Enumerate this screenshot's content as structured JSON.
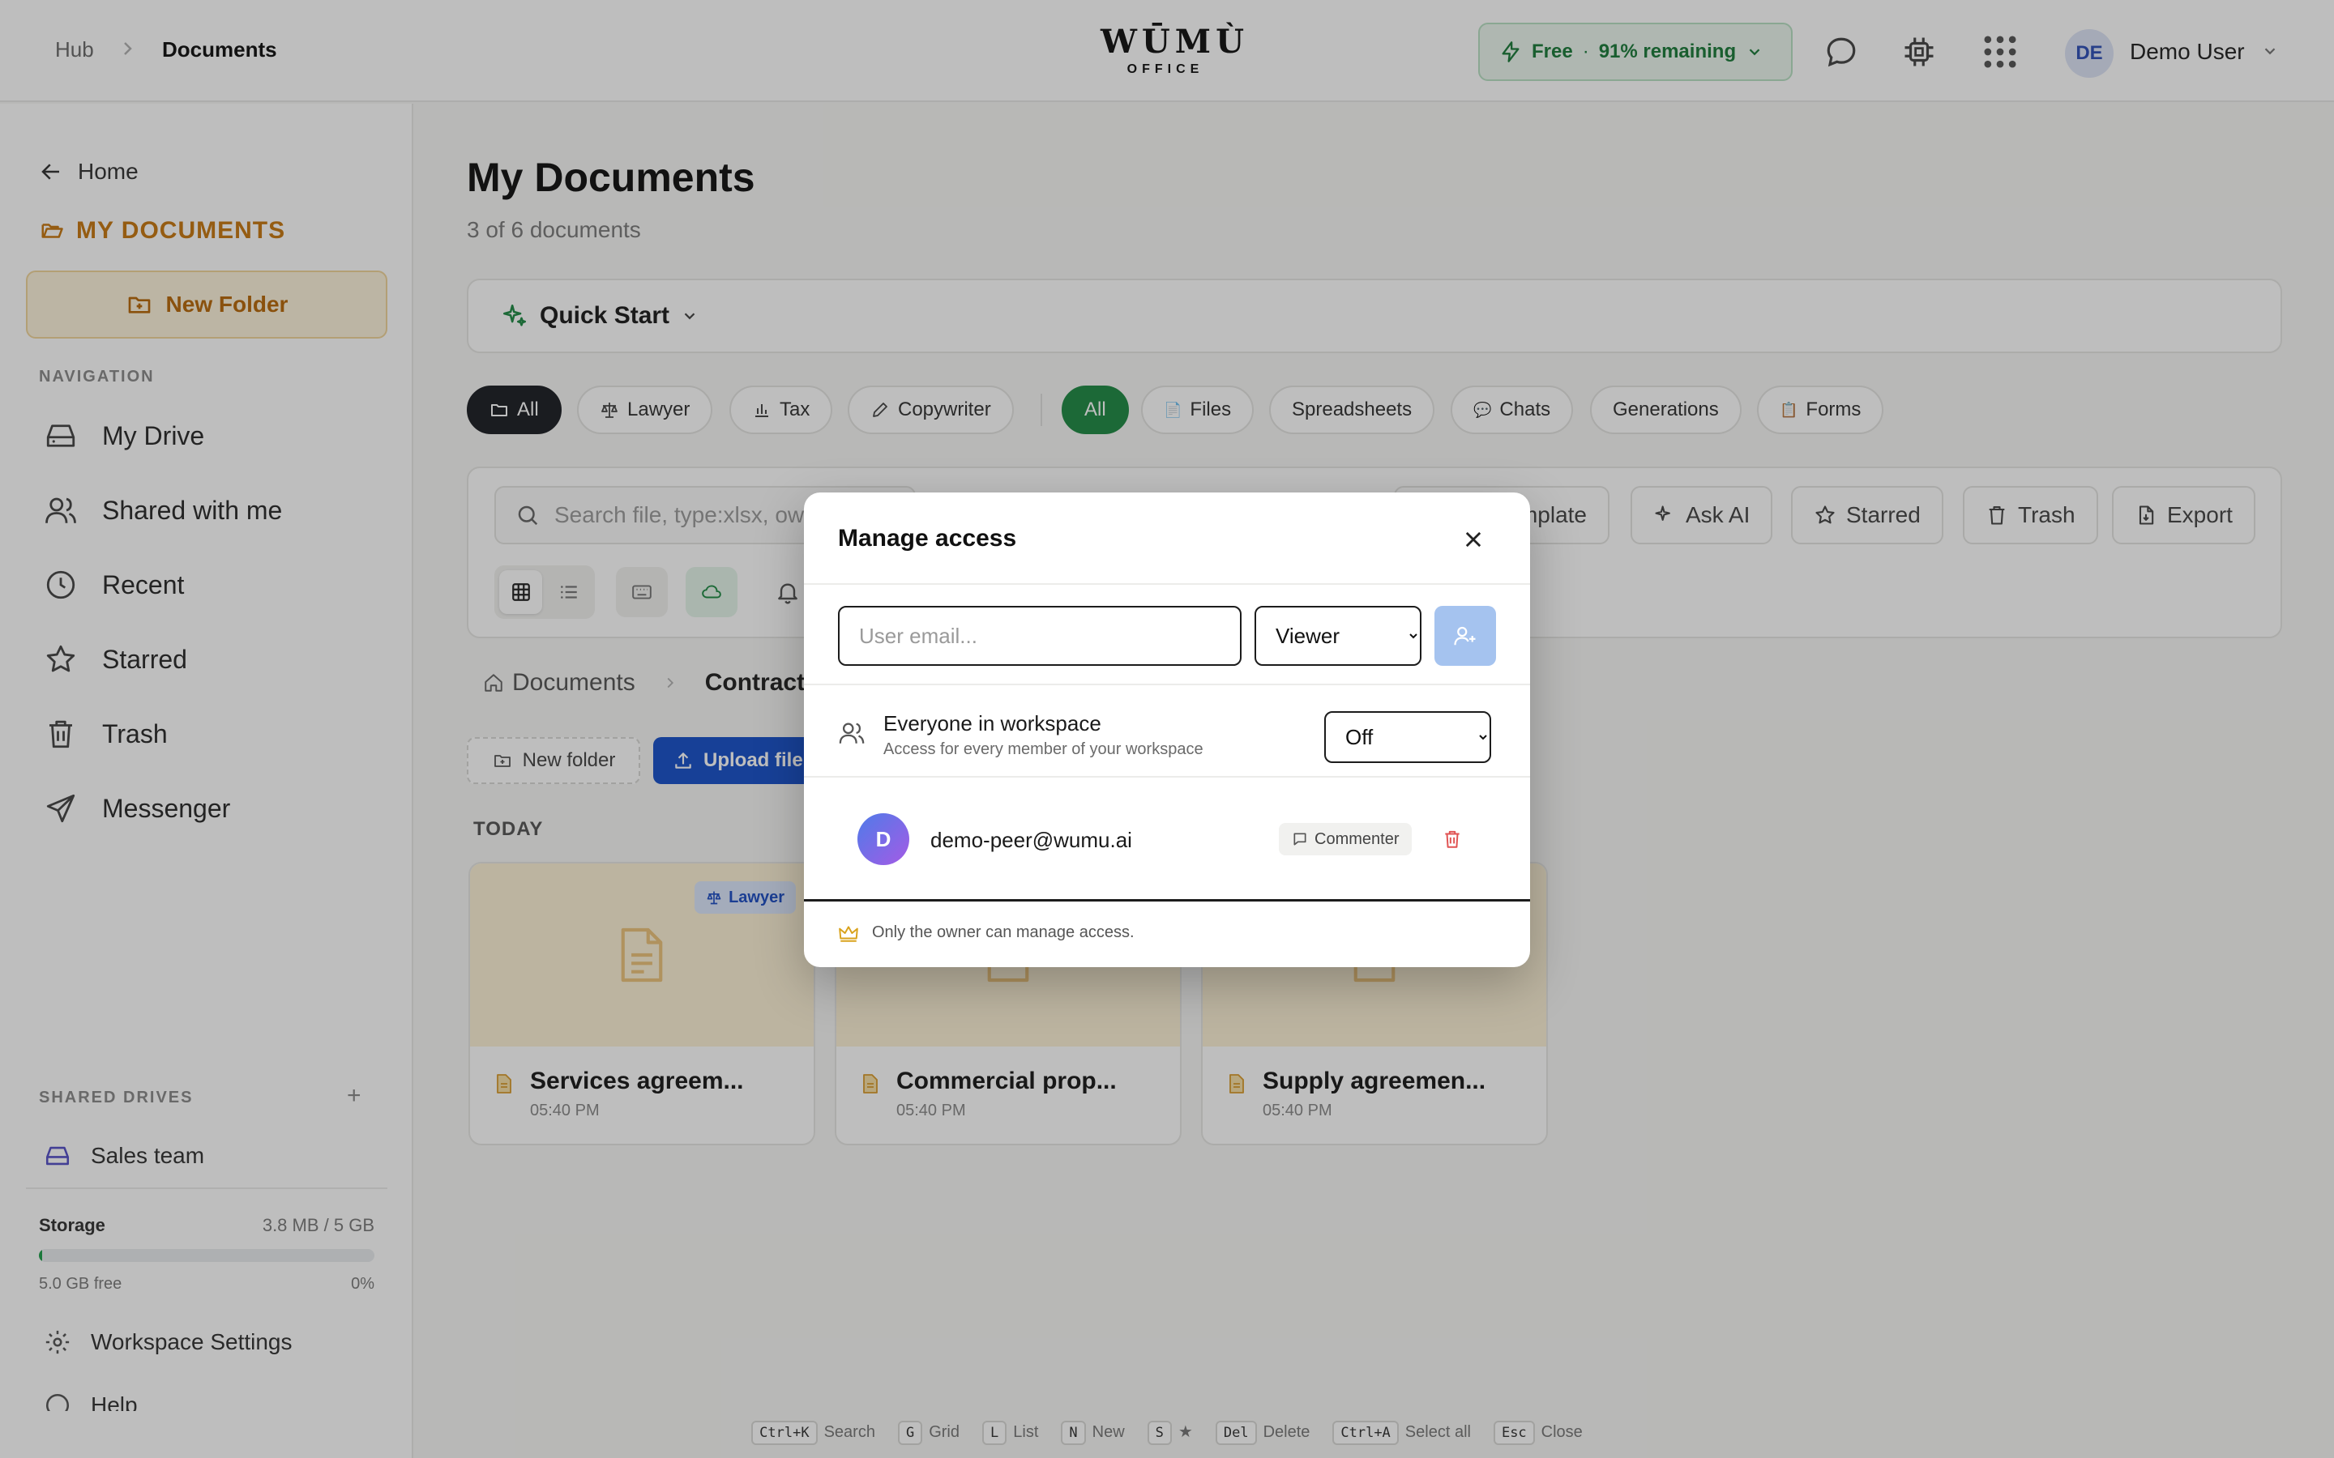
{
  "header": {
    "breadcrumb": [
      "Hub",
      "Documents"
    ],
    "logo_main": "WŪMÙ",
    "logo_sub": "OFFICE",
    "plan_label": "Free",
    "plan_sep": "·",
    "plan_remaining": "91% remaining",
    "user_initials": "DE",
    "user_name": "Demo User"
  },
  "sidebar": {
    "home": "Home",
    "my_documents": "MY DOCUMENTS",
    "new_folder": "New Folder",
    "navigation_label": "NAVIGATION",
    "nav_items": [
      {
        "label": "My Drive",
        "icon": "drive-icon"
      },
      {
        "label": "Shared with me",
        "icon": "users-icon"
      },
      {
        "label": "Recent",
        "icon": "clock-icon"
      },
      {
        "label": "Starred",
        "icon": "star-icon"
      },
      {
        "label": "Trash",
        "icon": "trash-icon"
      },
      {
        "label": "Messenger",
        "icon": "send-icon"
      }
    ],
    "shared_drives_label": "SHARED DRIVES",
    "shared_drives_add": "+",
    "shared_drives": [
      {
        "label": "Sales team"
      }
    ],
    "storage": {
      "label": "Storage",
      "used": "3.8 MB / 5 GB",
      "free": "5.0 GB free",
      "percent_label": "0%",
      "fill_fraction": 0.01
    },
    "workspace_settings": "Workspace Settings",
    "help": "Help"
  },
  "main": {
    "title": "My Documents",
    "subtitle": "3 of 6 documents",
    "quick_start": "Quick Start",
    "role_chips": [
      {
        "label": "All"
      },
      {
        "label": "Lawyer"
      },
      {
        "label": "Tax"
      },
      {
        "label": "Copywriter"
      }
    ],
    "type_chips": [
      {
        "label": "All"
      },
      {
        "label": "Files",
        "icon": "📄"
      },
      {
        "label": "Spreadsheets"
      },
      {
        "label": "Chats",
        "icon": "💬"
      },
      {
        "label": "Generations"
      },
      {
        "label": "Forms",
        "icon": "📋"
      }
    ],
    "search_placeholder": "Search file, type:xlsx, ow",
    "toolbar": {
      "template_partial": "mplate",
      "ask_ai": "Ask AI",
      "starred": "Starred",
      "trash": "Trash",
      "export": "Export"
    },
    "breadcrumb": {
      "root": "Documents",
      "current": "Contracts"
    },
    "new_folder": "New folder",
    "upload": "Upload file",
    "today": "TODAY",
    "cards": [
      {
        "title": "Services agreem...",
        "time": "05:40 PM",
        "tag": "Lawyer"
      },
      {
        "title": "Commercial prop...",
        "time": "05:40 PM"
      },
      {
        "title": "Supply agreemen...",
        "time": "05:40 PM"
      }
    ]
  },
  "shortcuts": [
    {
      "key": "Ctrl+K",
      "label": "Search"
    },
    {
      "key": "G",
      "label": "Grid"
    },
    {
      "key": "L",
      "label": "List"
    },
    {
      "key": "N",
      "label": "New"
    },
    {
      "key": "S",
      "label": "★"
    },
    {
      "key": "Del",
      "label": "Delete"
    },
    {
      "key": "Ctrl+A",
      "label": "Select all"
    },
    {
      "key": "Esc",
      "label": "Close"
    }
  ],
  "modal": {
    "title": "Manage access",
    "email_placeholder": "User email...",
    "role_options": [
      "Viewer"
    ],
    "role_selected": "Viewer",
    "workspace_title": "Everyone in workspace",
    "workspace_sub": "Access for every member of your workspace",
    "workspace_options": [
      "Off"
    ],
    "workspace_selected": "Off",
    "member": {
      "initial": "D",
      "email": "demo-peer@wumu.ai",
      "role": "Commenter"
    },
    "footer": "Only the owner can manage access."
  },
  "colors": {
    "accent": "#1851c9",
    "brand_orange": "#c77811",
    "green": "#1f8a44",
    "danger": "#e05252"
  }
}
